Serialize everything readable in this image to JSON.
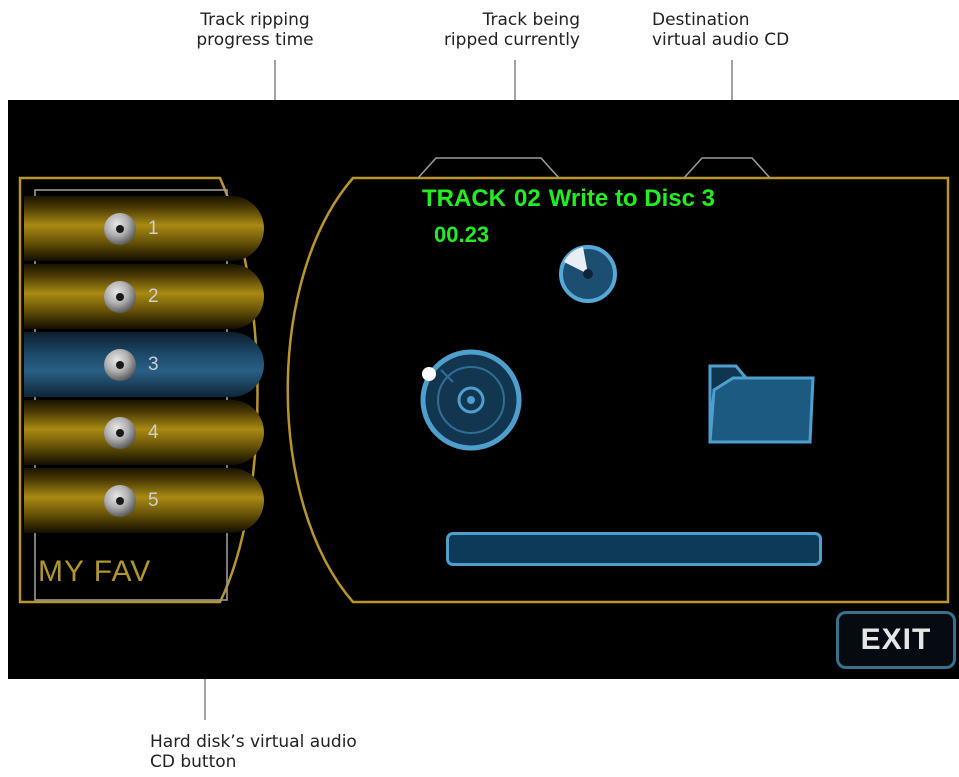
{
  "callouts": {
    "rip_time": [
      "Track ripping",
      "progress time"
    ],
    "track": [
      "Track being",
      "ripped currently"
    ],
    "destination": [
      "Destination",
      "virtual audio CD"
    ],
    "hd_button": [
      "Hard disk’s virtual audio",
      "CD button"
    ]
  },
  "sidebar": {
    "items": [
      {
        "label": "1",
        "state": "normal"
      },
      {
        "label": "2",
        "state": "normal"
      },
      {
        "label": "3",
        "state": "selected"
      },
      {
        "label": "4",
        "state": "normal"
      },
      {
        "label": "5",
        "state": "normal"
      }
    ],
    "fav_label": "MY FAV"
  },
  "status": {
    "track_word": "TRACK",
    "track_number": "02",
    "action": "Write to Disc 3",
    "progress_time": "00.23"
  },
  "icons": {
    "small_disc": "disc-icon",
    "large_disc": "cd-icon",
    "folder": "folder-icon"
  },
  "progress": {
    "fraction": 0.0
  },
  "exit_label": "EXIT",
  "colors": {
    "status_text": "#22ee22",
    "frame_gold": "#b8962a",
    "icon_blue": "#4f9fcc",
    "selected_button": "#2a5f85"
  }
}
